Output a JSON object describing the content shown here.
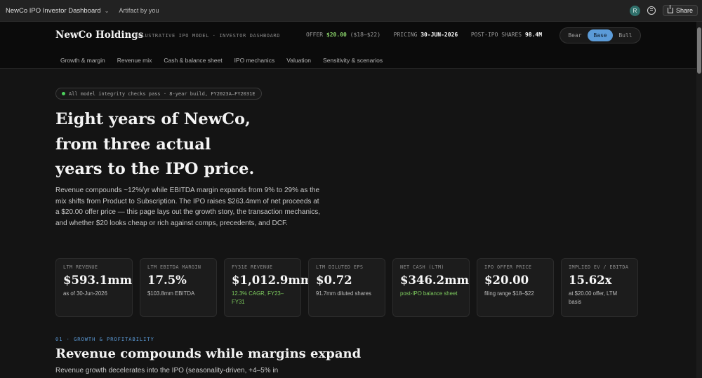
{
  "appbar": {
    "title": "NewCo IPO Investor Dashboard",
    "artifact_label": "Artifact by you",
    "avatar_initial": "R",
    "share_label": "Share"
  },
  "header": {
    "brand": "NewCo Holdings",
    "tagline": "ILLUSTRATIVE IPO MODEL · INVESTOR DASHBOARD",
    "offer_label": "OFFER",
    "offer_value": "$20.00",
    "offer_range": "($18–$22)",
    "pricing_label": "PRICING",
    "pricing_value": "30-JUN-2026",
    "shares_label": "POST-IPO SHARES",
    "shares_value": "98.4M",
    "scenarios": [
      "Bear",
      "Base",
      "Bull"
    ],
    "active_scenario": "Base"
  },
  "nav": {
    "items": [
      "Growth & margin",
      "Revenue mix",
      "Cash & balance sheet",
      "IPO mechanics",
      "Valuation",
      "Sensitivity & scenarios"
    ]
  },
  "hero": {
    "status_pill": "All model integrity checks pass · 8-year build, FY2023A–FY2031E",
    "headline_lines": [
      "Eight years of NewCo,",
      "from three actual",
      "years to the IPO price."
    ],
    "lede": "Revenue compounds ~12%/yr while EBITDA margin expands from 9% to 29% as the mix shifts from Product to Subscription. The IPO raises $263.4mm of net proceeds at a $20.00 offer price — this page lays out the growth story, the transaction mechanics, and whether $20 looks cheap or rich against comps, precedents, and DCF."
  },
  "kpis": [
    {
      "label": "LTM REVENUE",
      "value": "$593.1mm",
      "sub": "as of 30-Jun-2026",
      "sub_color": "default"
    },
    {
      "label": "LTM EBITDA MARGIN",
      "value": "17.5%",
      "sub": "$103.8mm EBITDA",
      "sub_color": "default"
    },
    {
      "label": "FY31E REVENUE",
      "value": "$1,012.9mm",
      "sub": "12.3% CAGR, FY23–FY31",
      "sub_color": "green"
    },
    {
      "label": "LTM DILUTED EPS",
      "value": "$0.72",
      "sub": "91.7mm diluted shares",
      "sub_color": "default"
    },
    {
      "label": "NET CASH (LTM)",
      "value": "$346.2mm",
      "sub": "post-IPO balance sheet",
      "sub_color": "green"
    },
    {
      "label": "IPO OFFER PRICE",
      "value": "$20.00",
      "sub": "filing range $18–$22",
      "sub_color": "default"
    },
    {
      "label": "IMPLIED EV / EBITDA",
      "value": "15.62x",
      "sub": "at $20.00 offer, LTM basis",
      "sub_color": "default"
    }
  ],
  "section": {
    "label": "01 · GROWTH & PROFITABILITY",
    "title": "Revenue compounds while margins expand",
    "body": "Revenue growth decelerates into the IPO (seasonality-driven, +4–5% in"
  },
  "colors": {
    "accent_blue": "#5b9bd8",
    "positive_green": "#7cc95d",
    "status_dot": "#4cd15c",
    "background": "#141414"
  }
}
